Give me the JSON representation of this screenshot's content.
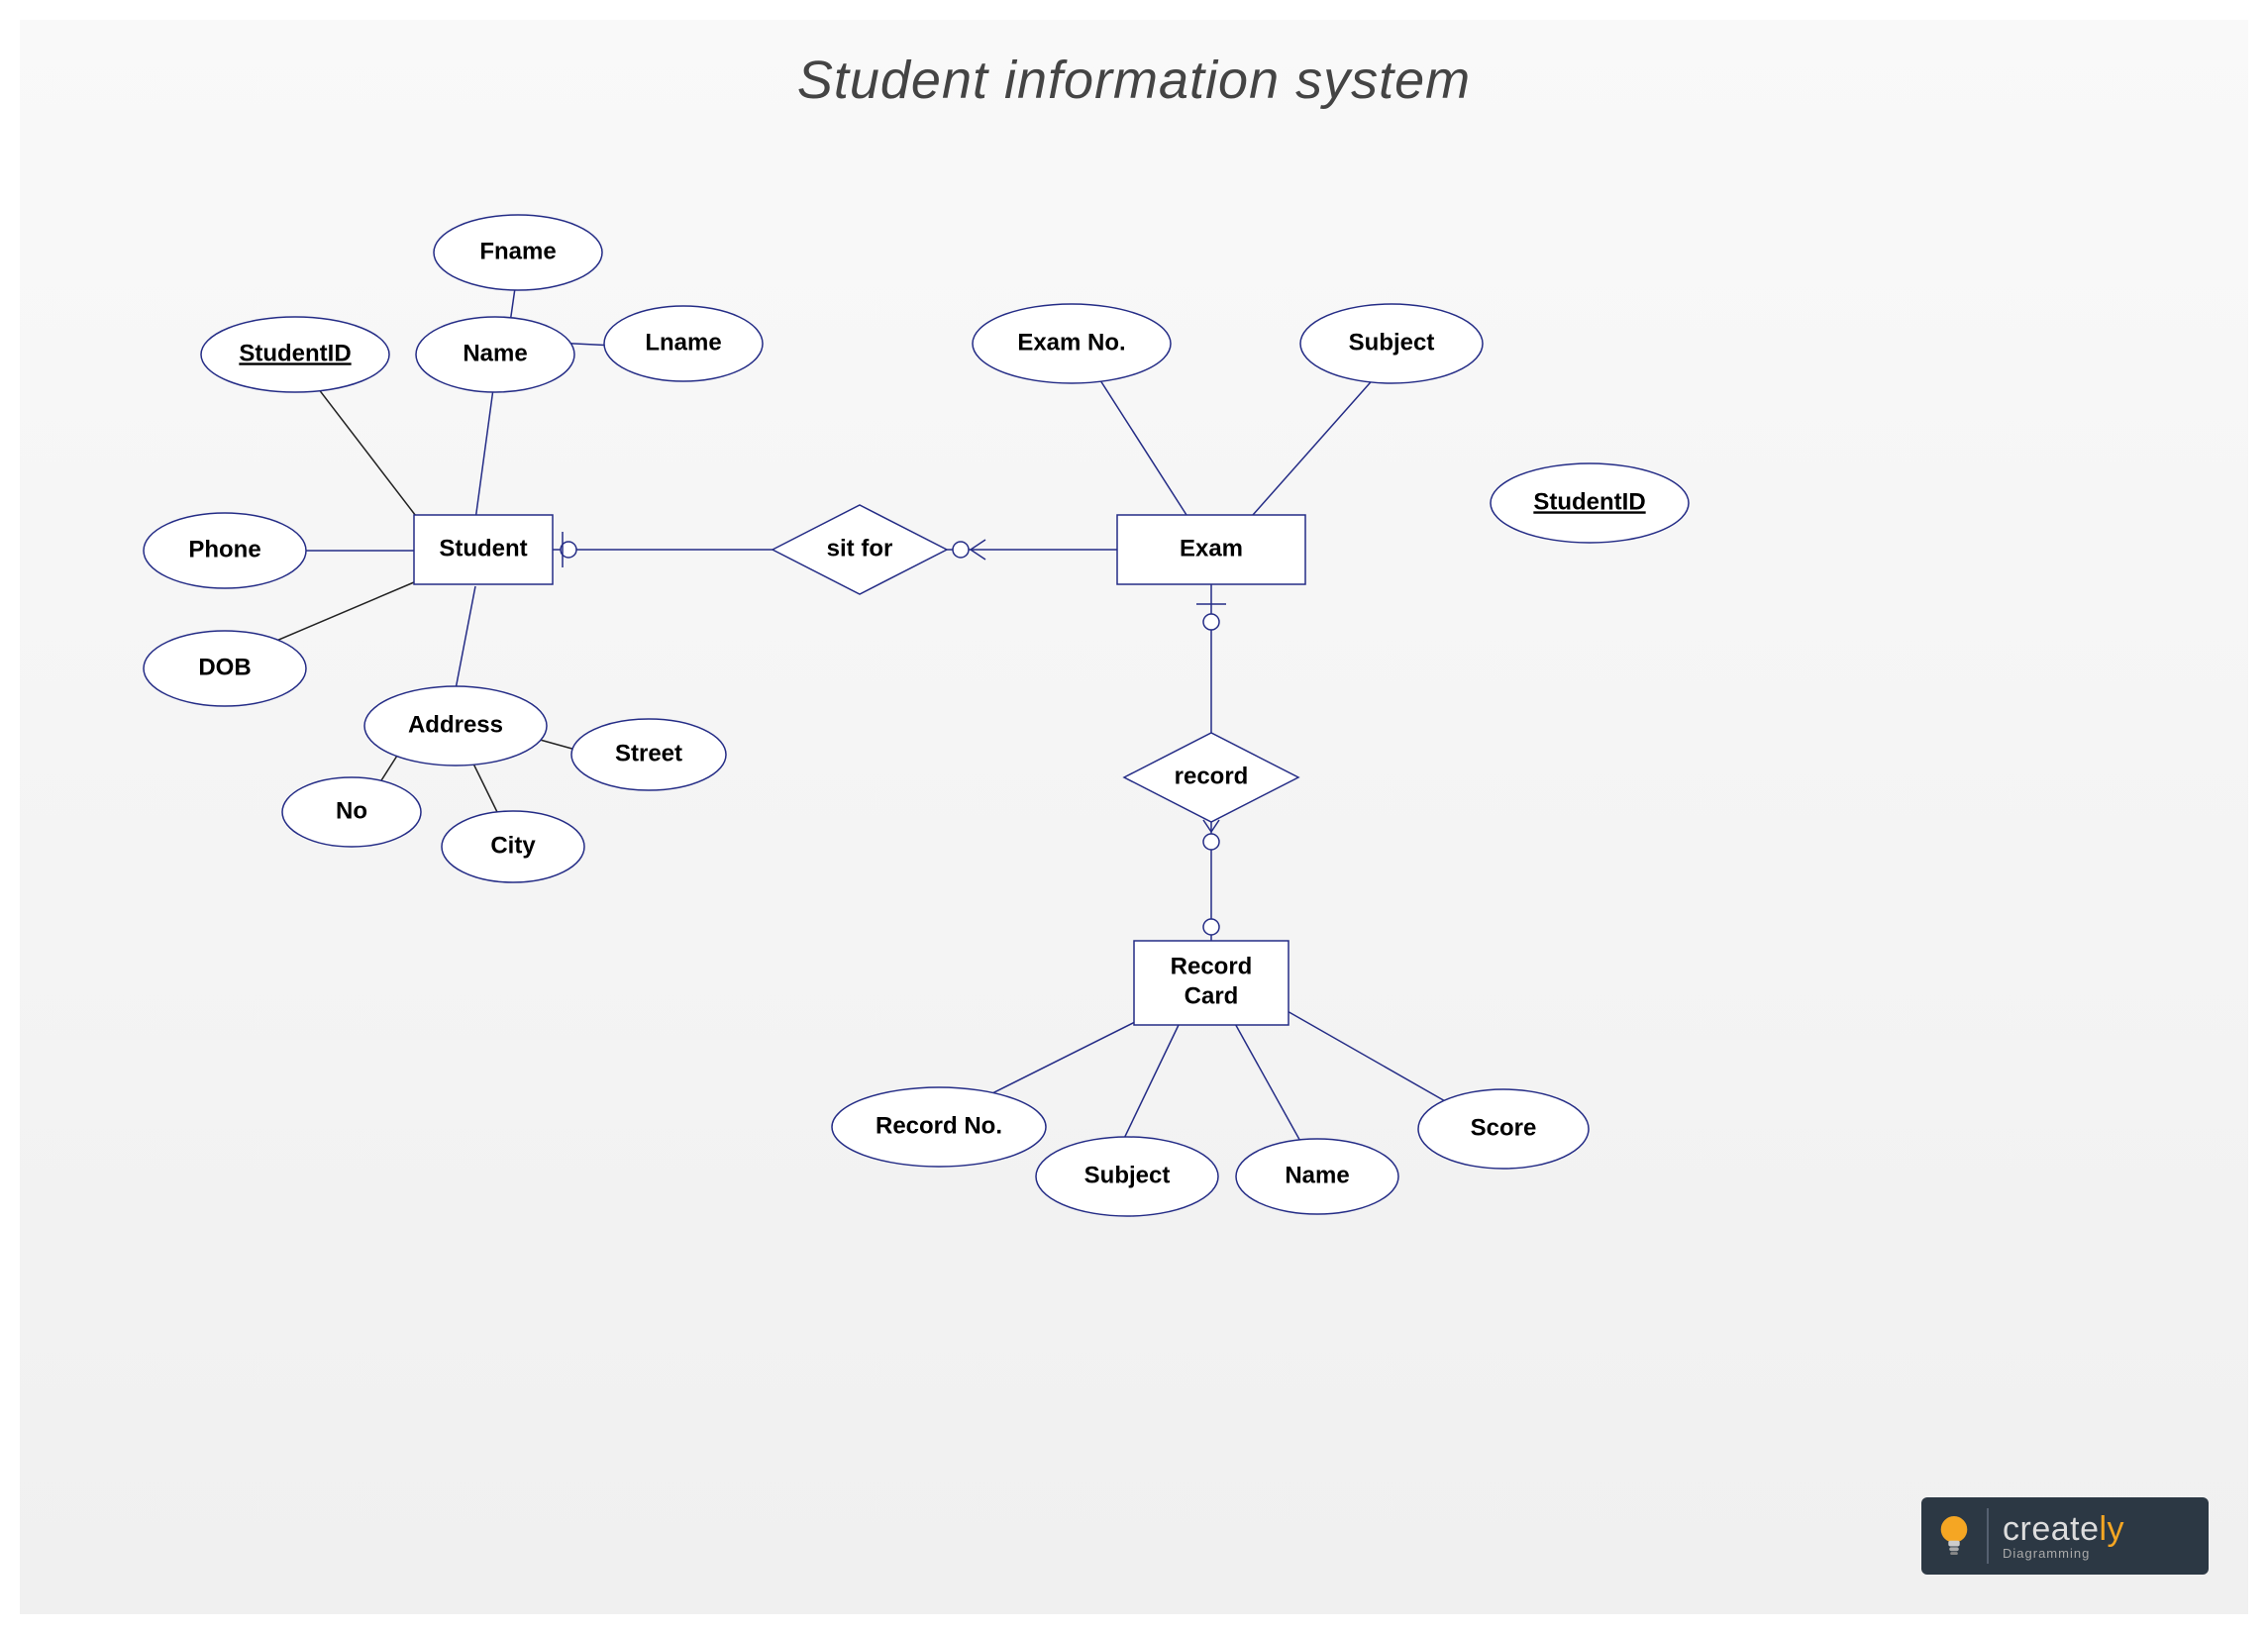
{
  "title": "Student information system",
  "entities": {
    "student": "Student",
    "exam": "Exam",
    "record_card_l1": "Record",
    "record_card_l2": "Card"
  },
  "relationships": {
    "sit_for": "sit for",
    "record": "record"
  },
  "attributes": {
    "fname": "Fname",
    "name": "Name",
    "lname": "Lname",
    "student_id": "StudentID",
    "phone": "Phone",
    "dob": "DOB",
    "address": "Address",
    "no": "No",
    "city": "City",
    "street": "Street",
    "exam_no": "Exam No.",
    "subject": "Subject",
    "student_id2": "StudentID",
    "record_no": "Record No.",
    "subject2": "Subject",
    "name2": "Name",
    "score": "Score"
  },
  "logo": {
    "brand1": "create",
    "brand2": "ly",
    "tag": "Diagramming"
  }
}
